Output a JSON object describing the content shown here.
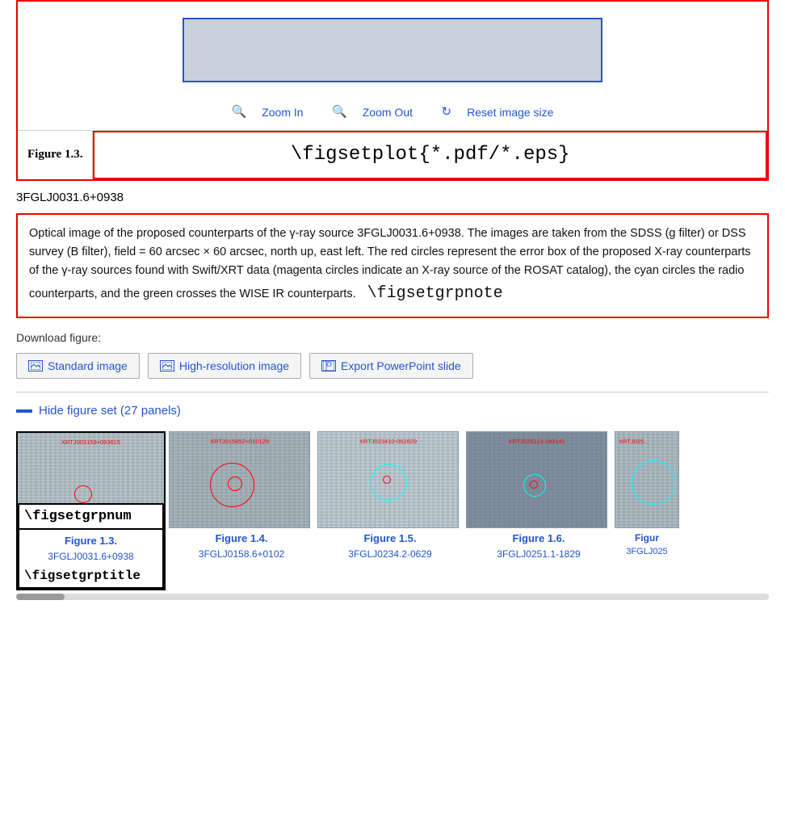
{
  "zoom": {
    "zoom_in_label": "Zoom In",
    "zoom_out_label": "Zoom Out",
    "reset_label": "Reset image size"
  },
  "figure": {
    "label": "Figure 1.3.",
    "plot_placeholder": "\\figsetplot{*.pdf/*.eps}",
    "group_id": "3FGLJ0031.6+0938"
  },
  "caption": {
    "text": "Optical image of the proposed counterparts of the γ-ray source 3FGLJ0031.6+0938. The images are taken from the SDSS (g filter) or DSS survey (B filter), field = 60 arcsec × 60 arcsec, north up, east left. The red circles represent the error box of the proposed X-ray counterparts of the γ-ray sources found with Swift/XRT data (magenta circles indicate an X-ray source of the ROSAT catalog), the cyan circles the radio counterparts, and the green crosses the WISE IR counterparts.",
    "figset_note": "\\figsetgrpnote"
  },
  "download": {
    "label": "Download figure:",
    "standard_label": "Standard image",
    "hires_label": "High-resolution image",
    "ppt_label": "Export PowerPoint slide"
  },
  "figureset": {
    "toggle_label": "Hide figure set (27 panels)",
    "figsetgrpnum": "\\figsetgrpnum",
    "figsetgrptitle": "\\figsetgrptitle",
    "panels": [
      {
        "xrt_label": "XRTJ003159+093615",
        "figure_link": "Figure 1.3.",
        "figure_sub": "3FGLJ0031.6+0938"
      },
      {
        "xrt_label": "XRTJ015852+010129",
        "figure_link": "Figure 1.4.",
        "figure_sub": "3FGLJ0158.6+0102"
      },
      {
        "xrt_label": "XRTJ023410-062829",
        "figure_link": "Figure 1.5.",
        "figure_sub": "3FGLJ0234.2-0629"
      },
      {
        "xrt_label": "XRTJ025113-183141",
        "figure_link": "Figure 1.6.",
        "figure_sub": "3FGLJ0251.1-1829"
      },
      {
        "xrt_label": "XRTJ025...",
        "figure_link": "Figur",
        "figure_sub": "3FGLJ025"
      }
    ]
  }
}
